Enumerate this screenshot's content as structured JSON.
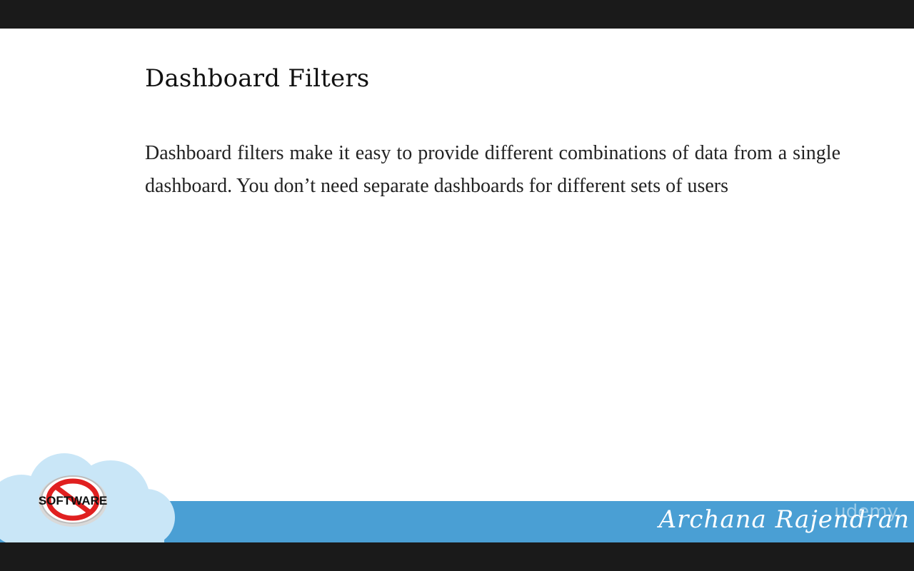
{
  "slide": {
    "title": "Dashboard Filters",
    "body": "Dashboard filters make it easy to provide different combinations of data from a single dashboard. You don’t need separate dashboards for different sets of users"
  },
  "footer": {
    "logo_text": "SOFTWARE",
    "author": "Archana Rajendran",
    "watermark": "udemy"
  },
  "colors": {
    "background": "#ffffff",
    "footer_band": "#4a9fd4",
    "cloud": "#c9e6f7",
    "logo_ring": "#e02020",
    "letterbox": "#1a1a1a"
  },
  "icons": [
    "cloud-shape",
    "no-software-logo"
  ]
}
